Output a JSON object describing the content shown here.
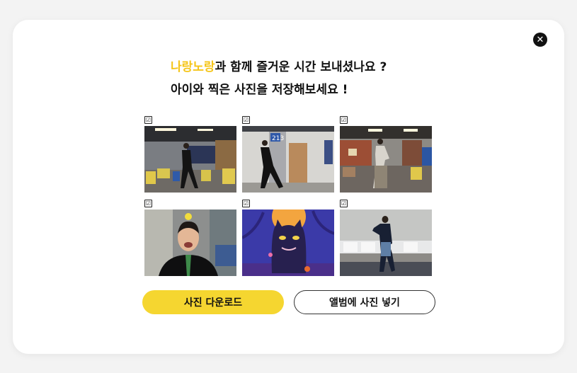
{
  "title": {
    "line1_highlight": "나랑노랑",
    "line1_rest": "과 함께 즐거운 시간 보내셨나요 ?",
    "line2": "아이와 찍은 사진을 저장해보세요 !"
  },
  "photos": [
    {
      "checked": true,
      "check_glyph": "☑"
    },
    {
      "checked": true,
      "check_glyph": "☑",
      "room_number": "213"
    },
    {
      "checked": true,
      "check_glyph": "☑"
    },
    {
      "checked": true,
      "check_glyph": "☑"
    },
    {
      "checked": true,
      "check_glyph": "☑"
    },
    {
      "checked": true,
      "check_glyph": "☑"
    }
  ],
  "buttons": {
    "download": "사진 다운로드",
    "album": "앨범에 사진 넣기"
  },
  "close_glyph": "✕",
  "colors": {
    "accent_yellow": "#f5d630",
    "highlight_text": "#f5c518",
    "close_bg": "#111111"
  },
  "icons": [
    "close-icon",
    "checkbox-checked-icon"
  ]
}
